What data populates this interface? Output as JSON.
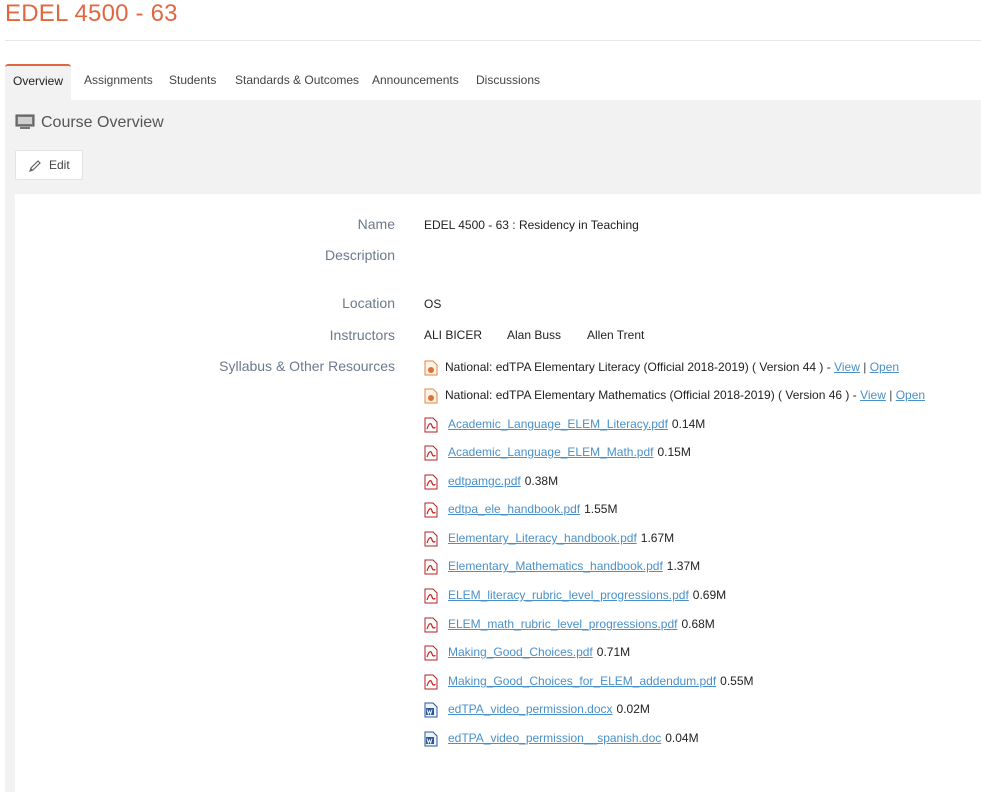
{
  "course": {
    "title": "EDEL 4500 - 63"
  },
  "tabs": [
    {
      "label": "Overview",
      "active": true
    },
    {
      "label": "Assignments"
    },
    {
      "label": "Students"
    },
    {
      "label": "Standards & Outcomes"
    },
    {
      "label": "Announcements"
    },
    {
      "label": "Discussions"
    }
  ],
  "overview": {
    "heading": "Course Overview",
    "edit_label": "Edit"
  },
  "fields": {
    "name_label": "Name",
    "name_value": "EDEL 4500 - 63 : Residency in Teaching",
    "description_label": "Description",
    "location_label": "Location",
    "location_value": "OS",
    "instructors_label": "Instructors",
    "instructors": [
      "ALI BICER",
      "Alan Buss",
      "Allen Trent"
    ],
    "resources_label": "Syllabus & Other Resources"
  },
  "resources": [
    {
      "type": "edtpa",
      "name": "National: edTPA Elementary Literacy (Official 2018-2019) ( Version 44 ) -",
      "view": "View",
      "sep": "|",
      "open": "Open"
    },
    {
      "type": "edtpa",
      "name": "National: edTPA Elementary Mathematics (Official 2018-2019) ( Version 46 ) -",
      "view": "View",
      "sep": "|",
      "open": "Open"
    },
    {
      "type": "pdf",
      "file": "Academic_Language_ELEM_Literacy.pdf",
      "size": "0.14M"
    },
    {
      "type": "pdf",
      "file": "Academic_Language_ELEM_Math.pdf",
      "size": "0.15M"
    },
    {
      "type": "pdf",
      "file": "edtpamgc.pdf",
      "size": "0.38M"
    },
    {
      "type": "pdf",
      "file": "edtpa_ele_handbook.pdf",
      "size": "1.55M"
    },
    {
      "type": "pdf",
      "file": "Elementary_Literacy_handbook.pdf",
      "size": "1.67M"
    },
    {
      "type": "pdf",
      "file": "Elementary_Mathematics_handbook.pdf",
      "size": "1.37M"
    },
    {
      "type": "pdf",
      "file": "ELEM_literacy_rubric_level_progressions.pdf",
      "size": "0.69M"
    },
    {
      "type": "pdf",
      "file": "ELEM_math_rubric_level_progressions.pdf",
      "size": "0.68M"
    },
    {
      "type": "pdf",
      "file": "Making_Good_Choices.pdf",
      "size": "0.71M"
    },
    {
      "type": "pdf",
      "file": "Making_Good_Choices_for_ELEM_addendum.pdf",
      "size": "0.55M"
    },
    {
      "type": "word",
      "file": "edTPA_video_permission.docx",
      "size": "0.02M"
    },
    {
      "type": "word",
      "file": "edTPA_video_permission__spanish.doc",
      "size": "0.04M"
    }
  ],
  "colors": {
    "accent": "#e06840",
    "link": "#4a90c9",
    "label": "#6b7a8c",
    "panel": "#f2f2f2"
  }
}
